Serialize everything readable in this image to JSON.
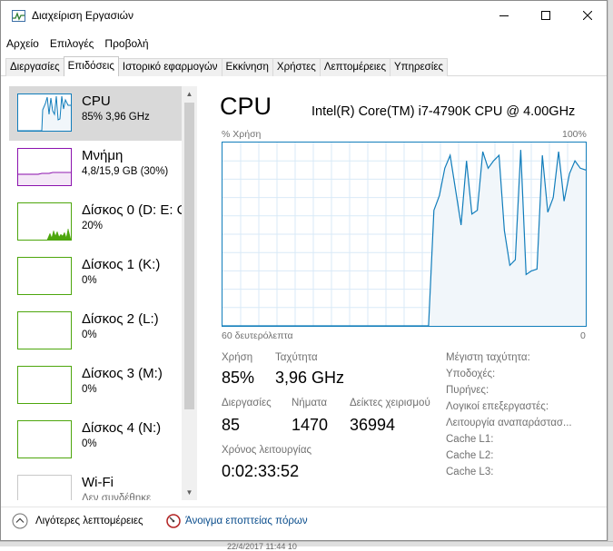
{
  "window": {
    "title": "Διαχείριση Εργασιών"
  },
  "menu": [
    "Αρχείο",
    "Επιλογές",
    "Προβολή"
  ],
  "tabs": [
    "Διεργασίες",
    "Επιδόσεις",
    "Ιστορικό εφαρμογών",
    "Εκκίνηση",
    "Χρήστες",
    "Λεπτομέρειες",
    "Υπηρεσίες"
  ],
  "active_tab": "Επιδόσεις",
  "sidebar": {
    "items": [
      {
        "name": "CPU",
        "sub": "85% 3,96 GHz",
        "color": "#117dbb",
        "selected": true
      },
      {
        "name": "Μνήμη",
        "sub": "4,8/15,9 GB (30%)",
        "color": "#8b12ae"
      },
      {
        "name": "Δίσκος 0 (D: E: C",
        "sub": "20%",
        "color": "#4da60c"
      },
      {
        "name": "Δίσκος 1 (K:)",
        "sub": "0%",
        "color": "#4da60c"
      },
      {
        "name": "Δίσκος 2 (L:)",
        "sub": "0%",
        "color": "#4da60c"
      },
      {
        "name": "Δίσκος 3 (M:)",
        "sub": "0%",
        "color": "#4da60c"
      },
      {
        "name": "Δίσκος 4 (N:)",
        "sub": "0%",
        "color": "#4da60c"
      },
      {
        "name": "Wi-Fi",
        "sub": "Δεν συνδέθηκε",
        "color": "#a74f01"
      }
    ]
  },
  "main": {
    "title": "CPU",
    "cpu_model": "Intel(R) Core(TM) i7-4790K CPU @ 4.00GHz",
    "graph_label_left": "% Χρήση",
    "graph_label_right": "100%",
    "graph_time_label": "60 δευτερόλεπτα",
    "graph_zero": "0",
    "usage_series": [
      0,
      0,
      0,
      0,
      0,
      0,
      0,
      0,
      0,
      0,
      0,
      0,
      0,
      0,
      0,
      0,
      0,
      0,
      0,
      0,
      0,
      0,
      0,
      0,
      0,
      0,
      0,
      0,
      0,
      0,
      0,
      0,
      0,
      0,
      0,
      0,
      0,
      0,
      0,
      63,
      71,
      86,
      93,
      74,
      55,
      90,
      61,
      63,
      95,
      86,
      90,
      93,
      52,
      33,
      36,
      96,
      28,
      30,
      31,
      93,
      62,
      70,
      95,
      68,
      83,
      90,
      86,
      85
    ]
  },
  "stats": {
    "usage_label": "Χρήση",
    "usage_value": "85%",
    "speed_label": "Ταχύτητα",
    "speed_value": "3,96 GHz",
    "processes_label": "Διεργασίες",
    "processes_value": "85",
    "threads_label": "Νήματα",
    "threads_value": "1470",
    "handles_label": "Δείκτες χειρισμού",
    "handles_value": "36994",
    "uptime_label": "Χρόνος λειτουργίας",
    "uptime_value": "0:02:33:52"
  },
  "specs": [
    "Μέγιστη ταχύτητα:",
    "Υποδοχές:",
    "Πυρήνες:",
    "Λογικοί επεξεργαστές:",
    "Λειτουργία αναπαράστασ...",
    "Cache L1:",
    "Cache L2:",
    "Cache L3:"
  ],
  "footer": {
    "fewer_details": "Λιγότερες λεπτομέρειες",
    "open_monitor": "Άνοιγμα εποπτείας πόρων"
  },
  "background_text": "22/4/2017 11:44 10"
}
